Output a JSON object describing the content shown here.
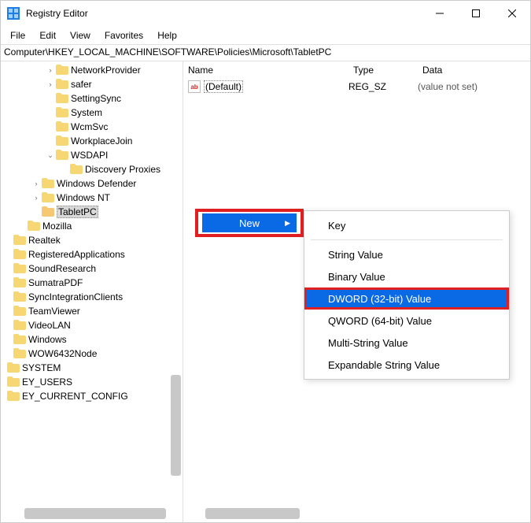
{
  "window": {
    "title": "Registry Editor"
  },
  "menu": {
    "file": "File",
    "edit": "Edit",
    "view": "View",
    "favorites": "Favorites",
    "help": "Help"
  },
  "address": "Computer\\HKEY_LOCAL_MACHINE\\SOFTWARE\\Policies\\Microsoft\\TabletPC",
  "tree": {
    "items": [
      {
        "indent": 3,
        "chev": "›",
        "label": "NetworkProvider",
        "shade": "y"
      },
      {
        "indent": 3,
        "chev": "›",
        "label": "safer",
        "shade": "y"
      },
      {
        "indent": 3,
        "chev": "",
        "label": "SettingSync",
        "shade": "y"
      },
      {
        "indent": 3,
        "chev": "",
        "label": "System",
        "shade": "y"
      },
      {
        "indent": 3,
        "chev": "",
        "label": "WcmSvc",
        "shade": "y"
      },
      {
        "indent": 3,
        "chev": "",
        "label": "WorkplaceJoin",
        "shade": "y"
      },
      {
        "indent": 3,
        "chev": "⌄",
        "label": "WSDAPI",
        "shade": "y"
      },
      {
        "indent": 4,
        "chev": "",
        "label": "Discovery Proxies",
        "shade": "y"
      },
      {
        "indent": 2,
        "chev": "›",
        "label": "Windows Defender",
        "shade": "y"
      },
      {
        "indent": 2,
        "chev": "›",
        "label": "Windows NT",
        "shade": "y"
      },
      {
        "indent": 2,
        "chev": "",
        "label": "TabletPC",
        "shade": "o",
        "selected": true
      },
      {
        "indent": 1,
        "chev": "",
        "label": "Mozilla",
        "shade": "y"
      },
      {
        "indent": 0,
        "chev": "",
        "label": "Realtek",
        "shade": "y"
      },
      {
        "indent": 0,
        "chev": "",
        "label": "RegisteredApplications",
        "shade": "y"
      },
      {
        "indent": 0,
        "chev": "",
        "label": "SoundResearch",
        "shade": "y"
      },
      {
        "indent": 0,
        "chev": "",
        "label": "SumatraPDF",
        "shade": "y"
      },
      {
        "indent": 0,
        "chev": "",
        "label": "SyncIntegrationClients",
        "shade": "y"
      },
      {
        "indent": 0,
        "chev": "",
        "label": "TeamViewer",
        "shade": "y"
      },
      {
        "indent": 0,
        "chev": "",
        "label": "VideoLAN",
        "shade": "y"
      },
      {
        "indent": 0,
        "chev": "",
        "label": "Windows",
        "shade": "y"
      },
      {
        "indent": 0,
        "chev": "",
        "label": "WOW6432Node",
        "shade": "y"
      },
      {
        "indent": -1,
        "chev": "",
        "label": "SYSTEM",
        "shade": "y"
      },
      {
        "indent": -1,
        "chev": "",
        "label": "EY_USERS",
        "shade": "y"
      },
      {
        "indent": -1,
        "chev": "",
        "label": "EY_CURRENT_CONFIG",
        "shade": "y"
      }
    ]
  },
  "list": {
    "headers": {
      "name": "Name",
      "type": "Type",
      "data": "Data"
    },
    "rows": [
      {
        "name": "(Default)",
        "type": "REG_SZ",
        "data": "(value not set)"
      }
    ]
  },
  "context": {
    "new": "New",
    "items": [
      {
        "label": "Key"
      },
      {
        "sep": true
      },
      {
        "label": "String Value"
      },
      {
        "label": "Binary Value"
      },
      {
        "label": "DWORD (32-bit) Value",
        "highlight": true
      },
      {
        "label": "QWORD (64-bit) Value"
      },
      {
        "label": "Multi-String Value"
      },
      {
        "label": "Expandable String Value"
      }
    ]
  }
}
